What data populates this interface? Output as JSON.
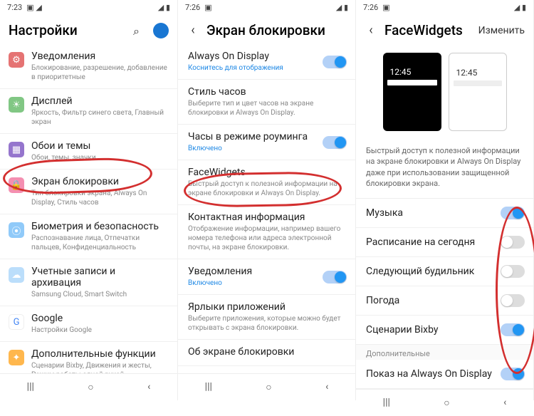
{
  "screen1": {
    "time": "7:23",
    "title": "Настройки",
    "items": [
      {
        "icon": "⚙",
        "cls": "ic-gear",
        "title": "Уведомления",
        "subtitle": "Блокирование, разрешение, добавление в приоритетные"
      },
      {
        "icon": "☀",
        "cls": "ic-display",
        "title": "Дисплей",
        "subtitle": "Яркость, Фильтр синего света, Главный экран"
      },
      {
        "icon": "▦",
        "cls": "ic-wall",
        "title": "Обои и темы",
        "subtitle": "Обои, темы, значки"
      },
      {
        "icon": "🔒",
        "cls": "ic-lock",
        "title": "Экран блокировки",
        "subtitle": "Тип блокировки экрана, Always On Display, Стиль часов"
      },
      {
        "icon": "⦿",
        "cls": "ic-bio",
        "title": "Биометрия и безопасность",
        "subtitle": "Распознавание лица, Отпечатки пальцев, Конфиденциальность"
      },
      {
        "icon": "☁",
        "cls": "ic-cloud",
        "title": "Учетные записи и архивация",
        "subtitle": "Samsung Cloud, Smart Switch"
      },
      {
        "icon": "G",
        "cls": "ic-google",
        "title": "Google",
        "subtitle": "Настройки Google"
      },
      {
        "icon": "✦",
        "cls": "ic-adv",
        "title": "Дополнительные функции",
        "subtitle": "Сценарии Bixby, Движения и жесты, Режим работы одной рукой"
      }
    ]
  },
  "screen2": {
    "time": "7:26",
    "title": "Экран блокировки",
    "items": [
      {
        "title": "Always On Display",
        "subtitle": "Коснитесь для отображения",
        "accent": true,
        "toggle": "on"
      },
      {
        "title": "Стиль часов",
        "subtitle": "Выберите тип и цвет часов на экране блокировки и Always On Display."
      },
      {
        "title": "Часы в режиме роуминга",
        "subtitle": "Включено",
        "accent": true,
        "toggle": "on"
      },
      {
        "title": "FaceWidgets",
        "subtitle": "Быстрый доступ к полезной информации на экране блокировки и Always On Display."
      },
      {
        "title": "Контактная информация",
        "subtitle": "Отображение информации, например вашего номера телефона или адреса электронной почты, на экране блокировки."
      },
      {
        "title": "Уведомления",
        "subtitle": "Включено",
        "accent": true,
        "toggle": "on"
      },
      {
        "title": "Ярлыки приложений",
        "subtitle": "Выберите приложения, которые можно будет открывать с экрана блокировки."
      },
      {
        "title": "Об экране блокировки",
        "subtitle": ""
      }
    ]
  },
  "screen3": {
    "time": "7:26",
    "title": "FaceWidgets",
    "action": "Изменить",
    "preview_time": "12:45",
    "description": "Быстрый доступ к полезной информации на экране блокировки и Always On Display даже при использовании защищенной блокировки экрана.",
    "switches": [
      {
        "label": "Музыка",
        "on": true
      },
      {
        "label": "Расписание на сегодня",
        "on": false
      },
      {
        "label": "Следующий будильник",
        "on": false
      },
      {
        "label": "Погода",
        "on": false
      },
      {
        "label": "Сценарии Bixby",
        "on": true
      }
    ],
    "section": "Дополнительные",
    "extra": {
      "label": "Показ на Always On Display",
      "on": true
    }
  },
  "nav": {
    "recent": "|||",
    "home": "○",
    "back": "‹"
  }
}
